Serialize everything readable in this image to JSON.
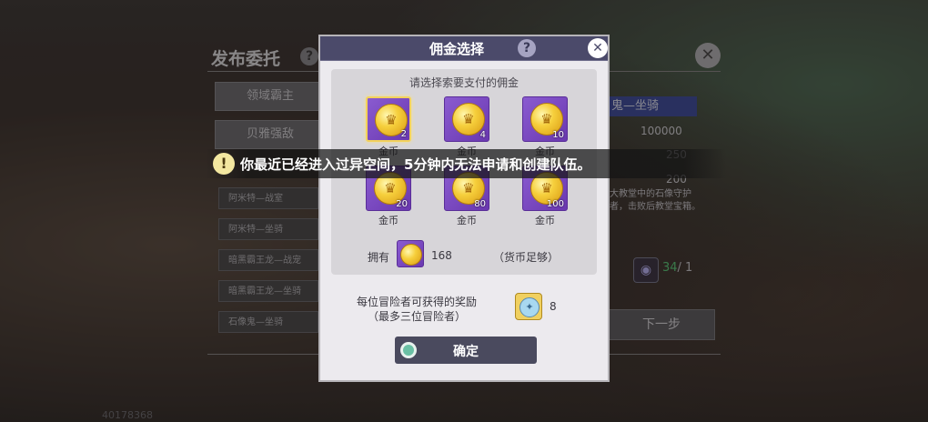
{
  "background_panel": {
    "title": "发布委托",
    "help_icon": "question-mark-icon",
    "close_icon": "close-x-icon",
    "categories": [
      "领域霸主",
      "贝雅强敌"
    ],
    "items": [
      "阿米特—战室",
      "阿米特—坐骑",
      "暗黑霸王龙—战宠",
      "暗黑霸王龙—坐骑",
      "石像鬼—坐骑"
    ],
    "right_header": "鬼—坐骑",
    "right_values": [
      "100000",
      "250",
      "200"
    ],
    "right_desc": "大教堂中的石像守护者，击败后教堂宝箱。",
    "count_have": "34",
    "count_total": "/ 1",
    "next_button": "下一步",
    "footer_id": "40178368"
  },
  "modal": {
    "title": "佣金选择",
    "help_icon": "question-mark-icon",
    "close_icon": "close-x-icon",
    "instruction": "请选择索要支付的佣金",
    "options": [
      {
        "qty": "2",
        "label": "金币",
        "selected": true
      },
      {
        "qty": "4",
        "label": "金币",
        "selected": false
      },
      {
        "qty": "10",
        "label": "金币",
        "selected": false
      },
      {
        "qty": "20",
        "label": "金币",
        "selected": false
      },
      {
        "qty": "80",
        "label": "金币",
        "selected": false
      },
      {
        "qty": "100",
        "label": "金币",
        "selected": false
      }
    ],
    "own_label": "拥有",
    "own_amount": "168",
    "enough_text": "（货币足够）",
    "reward_line1": "每位冒险者可获得的奖励",
    "reward_line2": "（最多三位冒险者）",
    "reward_count": "8",
    "confirm_label": "确定"
  },
  "toast": {
    "icon": "exclamation-icon",
    "text": "你最近已经进入过异空间，5分钟内无法申请和创建队伍。"
  },
  "colors": {
    "modal_header": "#4b4a6a",
    "coin_bg": "#7a48c0",
    "selected_border": "#f3d25c",
    "toast_bg": "#141414"
  }
}
